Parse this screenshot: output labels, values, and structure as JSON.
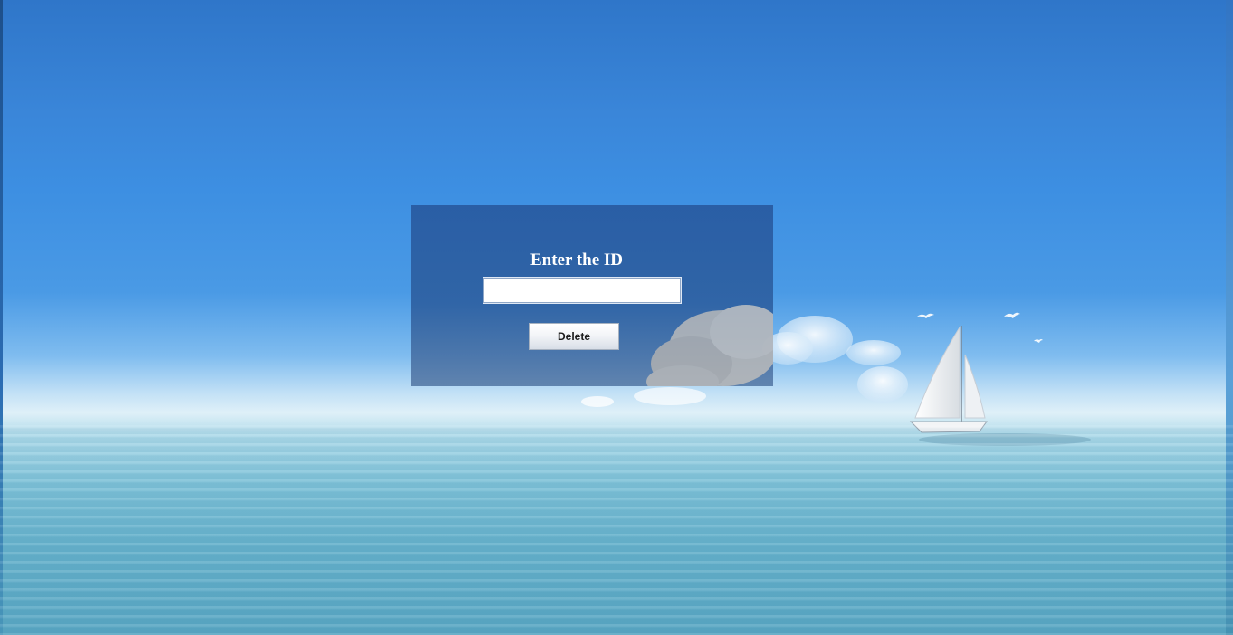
{
  "background": {
    "description_icon": "sailboat-ocean-wallpaper"
  },
  "dialog": {
    "title": "Enter the ID",
    "id_field": {
      "value": "",
      "placeholder": ""
    },
    "delete_label": "Delete"
  },
  "colors": {
    "dialog_bg": "#2d5fa0",
    "title_text": "#ffffff",
    "button_text": "#1a1a1a"
  }
}
